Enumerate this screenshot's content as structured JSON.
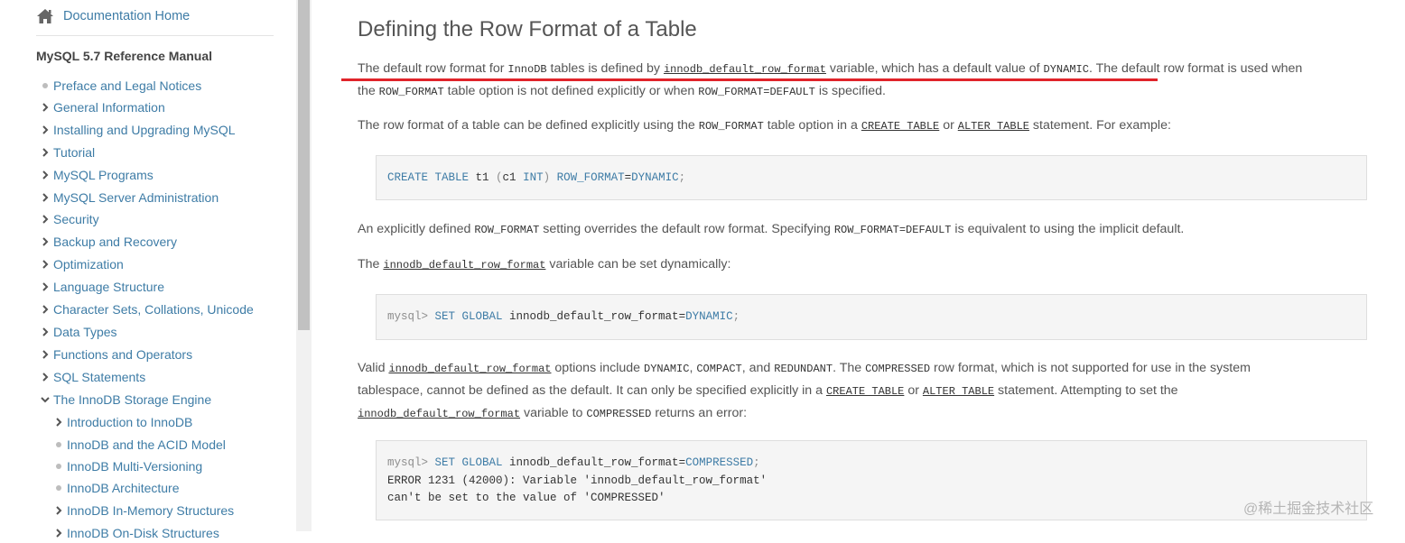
{
  "sidebar": {
    "home_label": "Documentation Home",
    "manual_title": "MySQL 5.7 Reference Manual",
    "items": [
      {
        "label": "Preface and Legal Notices",
        "marker": "bullet"
      },
      {
        "label": "General Information",
        "marker": "chevron-right"
      },
      {
        "label": "Installing and Upgrading MySQL",
        "marker": "chevron-right"
      },
      {
        "label": "Tutorial",
        "marker": "chevron-right"
      },
      {
        "label": "MySQL Programs",
        "marker": "chevron-right"
      },
      {
        "label": "MySQL Server Administration",
        "marker": "chevron-right"
      },
      {
        "label": "Security",
        "marker": "chevron-right"
      },
      {
        "label": "Backup and Recovery",
        "marker": "chevron-right"
      },
      {
        "label": "Optimization",
        "marker": "chevron-right"
      },
      {
        "label": "Language Structure",
        "marker": "chevron-right"
      },
      {
        "label": "Character Sets, Collations, Unicode",
        "marker": "chevron-right"
      },
      {
        "label": "Data Types",
        "marker": "chevron-right"
      },
      {
        "label": "Functions and Operators",
        "marker": "chevron-right"
      },
      {
        "label": "SQL Statements",
        "marker": "chevron-right"
      },
      {
        "label": "The InnoDB Storage Engine",
        "marker": "chevron-down"
      },
      {
        "label": "Introduction to InnoDB",
        "marker": "chevron-right",
        "sub": true
      },
      {
        "label": "InnoDB and the ACID Model",
        "marker": "bullet",
        "sub": true
      },
      {
        "label": "InnoDB Multi-Versioning",
        "marker": "bullet",
        "sub": true
      },
      {
        "label": "InnoDB Architecture",
        "marker": "bullet",
        "sub": true
      },
      {
        "label": "InnoDB In-Memory Structures",
        "marker": "chevron-right",
        "sub": true
      },
      {
        "label": "InnoDB On-Disk Structures",
        "marker": "chevron-right",
        "sub": true
      }
    ]
  },
  "content": {
    "title": "Defining the Row Format of a Table",
    "p1": {
      "a": "The default row format for ",
      "b": "InnoDB",
      "c": " tables is defined by ",
      "d": "innodb_default_row_format",
      "e": " variable, which has a default value of ",
      "f": "DYNAMIC",
      "g": ". The default row format is used when",
      "h": "the ",
      "i": "ROW_FORMAT",
      "j": " table option is not defined explicitly or when ",
      "k": "ROW_FORMAT=DEFAULT",
      "l": " is specified."
    },
    "p2": {
      "a": "The row format of a table can be defined explicitly using the ",
      "b": "ROW_FORMAT",
      "c": " table option in a ",
      "d": "CREATE TABLE",
      "e": " or ",
      "f": "ALTER TABLE",
      "g": " statement. For example:"
    },
    "code1": {
      "kw1": "CREATE TABLE",
      "t1": " t1 ",
      "p1": "(",
      "c1": "c1 ",
      "kw2": "INT",
      "p2": ")",
      "kw3": " ROW_FORMAT",
      "eq": "=",
      "kw4": "DYNAMIC",
      "semi": ";"
    },
    "p3": {
      "a": "An explicitly defined ",
      "b": "ROW_FORMAT",
      "c": " setting overrides the default row format. Specifying ",
      "d": "ROW_FORMAT=DEFAULT",
      "e": " is equivalent to using the implicit default."
    },
    "p4": {
      "a": "The ",
      "b": "innodb_default_row_format",
      "c": " variable can be set dynamically:"
    },
    "code2": {
      "prompt": "mysql> ",
      "kw1": "SET GLOBAL",
      "var": " innodb_default_row_format",
      "eq": "=",
      "val": "DYNAMIC",
      "semi": ";"
    },
    "p5": {
      "a": "Valid ",
      "b": "innodb_default_row_format",
      "c": " options include ",
      "d": "DYNAMIC",
      "e": ", ",
      "f": "COMPACT",
      "g": ", and ",
      "h": "REDUNDANT",
      "i": ". The ",
      "j": "COMPRESSED",
      "k": " row format, which is not supported for use in the system",
      "l": "tablespace, cannot be defined as the default. It can only be specified explicitly in a ",
      "m": "CREATE TABLE",
      "n": " or ",
      "o": "ALTER TABLE",
      "p": " statement. Attempting to set the",
      "q": "innodb_default_row_format",
      "r": " variable to ",
      "s": "COMPRESSED",
      "t": " returns an error:"
    },
    "code3": {
      "prompt": "mysql> ",
      "kw1": "SET GLOBAL",
      "var": " innodb_default_row_format",
      "eq": "=",
      "val": "COMPRESSED",
      "semi": ";",
      "line2": "ERROR 1231 (42000): Variable 'innodb_default_row_format'",
      "line3": "can't be set to the value of 'COMPRESSED'"
    }
  },
  "watermark": "@稀土掘金技术社区",
  "colors": {
    "link": "#3e7ca6",
    "highlight": "#e0242a",
    "code_bg": "#f5f5f5"
  }
}
